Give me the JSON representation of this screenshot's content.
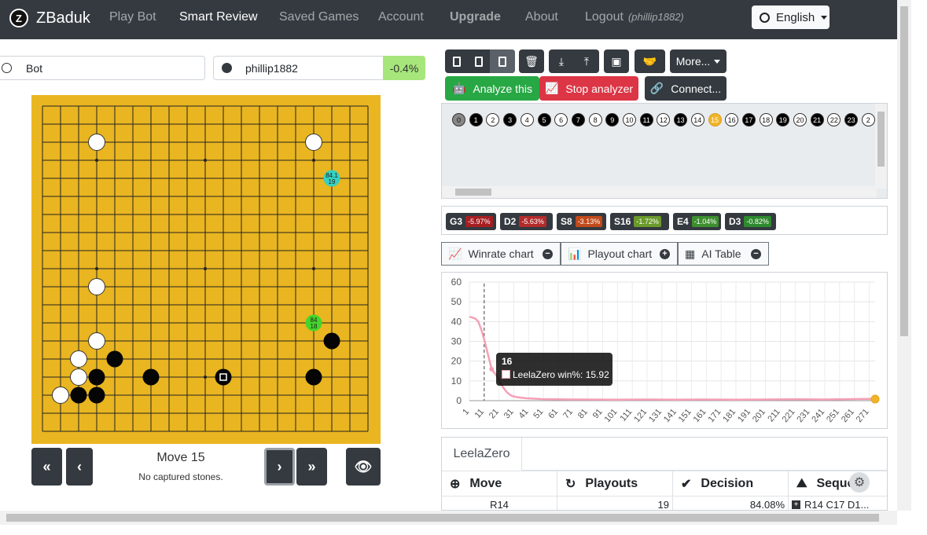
{
  "nav": {
    "brand": "ZBaduk",
    "items": [
      "Play Bot",
      "Smart Review",
      "Saved Games",
      "Account",
      "Upgrade",
      "About",
      "Logout"
    ],
    "user": "(phillip1882)",
    "language": "English"
  },
  "players": {
    "white": "Bot",
    "black": "phillip1882",
    "winrate_delta": "-0.4%"
  },
  "board": {
    "size": 19,
    "white_stones": [
      [
        4,
        3
      ],
      [
        16,
        3
      ],
      [
        4,
        11
      ],
      [
        4,
        14
      ],
      [
        3,
        15
      ],
      [
        3,
        16
      ],
      [
        2,
        17
      ]
    ],
    "black_stones": [
      [
        5,
        15
      ],
      [
        4,
        16
      ],
      [
        3,
        17
      ],
      [
        4,
        17
      ],
      [
        7,
        16
      ],
      [
        11,
        16
      ],
      [
        16,
        16
      ],
      [
        17,
        14
      ]
    ],
    "last_move": [
      11,
      16
    ],
    "suggestions": [
      {
        "point": [
          17,
          5
        ],
        "top": "84.1",
        "bottom": "19",
        "color": "#36d1c2"
      },
      {
        "point": [
          16,
          13
        ],
        "top": "84",
        "bottom": "18",
        "color": "#44d62c"
      }
    ]
  },
  "controls": {
    "move_label": "Move 15",
    "captured_label": "No captured stones."
  },
  "toolbar": {
    "more_label": "More...",
    "analyze_label": "Analyze this",
    "stop_label": "Stop analyzer",
    "connect_label": "Connect..."
  },
  "move_list": [
    "0",
    "1",
    "2",
    "3",
    "4",
    "5",
    "6",
    "7",
    "8",
    "9",
    "10",
    "11",
    "12",
    "13",
    "14",
    "15",
    "16",
    "17",
    "18",
    "19",
    "20",
    "21",
    "22",
    "23",
    "2"
  ],
  "best_moves": [
    {
      "move": "G3",
      "val": "-5.97%",
      "color": "#a61e22"
    },
    {
      "move": "D2",
      "val": "-5.63%",
      "color": "#b32a2a"
    },
    {
      "move": "S8",
      "val": "-3.13%",
      "color": "#c24a1a"
    },
    {
      "move": "S16",
      "val": "-1.72%",
      "color": "#6a9a2a"
    },
    {
      "move": "E4",
      "val": "-1.04%",
      "color": "#3d8f2e"
    },
    {
      "move": "D3",
      "val": "-0.82%",
      "color": "#2e8a2e"
    }
  ],
  "tabs": [
    {
      "label": "Winrate chart",
      "icon": "−"
    },
    {
      "label": "Playout chart",
      "icon": "+"
    },
    {
      "label": "AI Table",
      "icon": "−"
    }
  ],
  "tooltip": {
    "title": "16",
    "text": "LeelaZero win%: 15.92"
  },
  "chart_data": {
    "type": "line",
    "title": "",
    "xlabel": "",
    "ylabel": "",
    "ylim": [
      0,
      60
    ],
    "yticks": [
      0,
      10,
      20,
      30,
      40,
      50,
      60
    ],
    "xticks": [
      "1",
      "11",
      "21",
      "31",
      "41",
      "51",
      "61",
      "71",
      "81",
      "91",
      "101",
      "111",
      "121",
      "131",
      "141",
      "151",
      "161",
      "171",
      "181",
      "191",
      "201",
      "211",
      "221",
      "231",
      "241",
      "251",
      "261",
      "271"
    ],
    "series": [
      {
        "color": "#f4a0b5",
        "x": [
          1,
          3,
          5,
          7,
          9,
          11,
          13,
          15,
          16,
          18,
          20,
          22,
          24,
          26,
          28,
          30,
          33,
          36,
          40,
          45,
          50,
          60,
          70,
          80,
          100,
          120,
          140,
          160,
          180,
          200,
          220,
          240,
          260,
          270,
          275
        ],
        "y": [
          42.5,
          42,
          41.5,
          40,
          36,
          31,
          25,
          19,
          15.9,
          14,
          12,
          9,
          6.5,
          4.5,
          3.2,
          2.3,
          1.8,
          1.5,
          1.2,
          1.0,
          0.8,
          0.7,
          0.6,
          0.6,
          0.5,
          0.6,
          0.5,
          0.6,
          0.5,
          0.6,
          0.7,
          0.6,
          0.8,
          0.9,
          0.8
        ]
      }
    ],
    "current_x": 16
  },
  "ai_table": {
    "tab_label": "LeelaZero",
    "headers": [
      "Move",
      "Playouts",
      "Decision",
      "Seque"
    ],
    "row": [
      "R14",
      "19",
      "84.08%",
      "R14 C17 D1..."
    ]
  }
}
